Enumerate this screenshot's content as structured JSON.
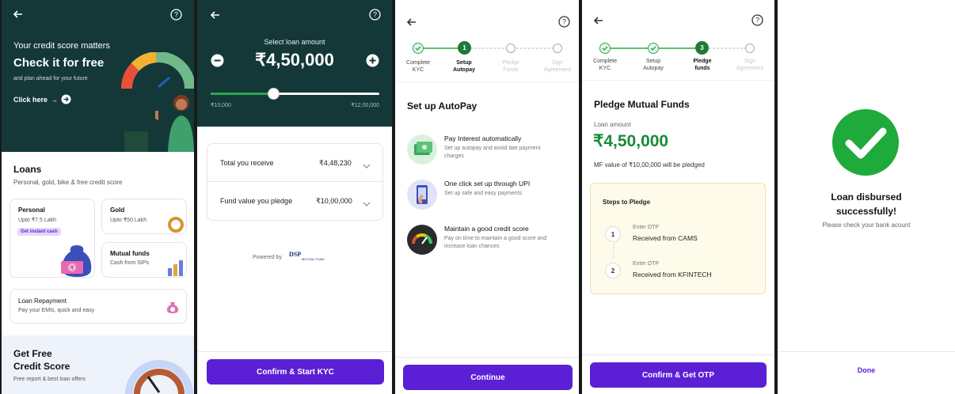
{
  "screen1": {
    "hero_subtitle": "Your credit score matters",
    "hero_title": "Check it for free",
    "hero_tagline": "and plan ahead for your future",
    "hero_link": "Click here",
    "loans_title": "Loans",
    "loans_subtitle": "Personal, gold, bike & free credit score",
    "personal_title": "Personal",
    "personal_sub": "Upto ₹7.5 Lakh",
    "personal_badge": "Get instant cash",
    "gold_title": "Gold",
    "gold_sub": "Upto ₹50 Lakh",
    "mf_title": "Mutual funds",
    "mf_sub": "Cash from SIPs",
    "repay_title": "Loan Repayment",
    "repay_sub": "Pay your EMIs, quick and easy",
    "promo_title_1": "Get Free",
    "promo_title_2": "Credit Score",
    "promo_sub": "Free report & best loan offers"
  },
  "screen2": {
    "select_label": "Select loan amount",
    "amount": "₹4,50,000",
    "slider_min": "₹10,000",
    "slider_max": "₹12,00,000",
    "slider_fraction": 0.37,
    "row1_label": "Total you receive",
    "row1_value": "₹4,48,230",
    "row2_label": "Fund value you pledge",
    "row2_value": "₹10,00,000",
    "powered_by": "Powered by",
    "powered_logo": "DSP",
    "powered_logo_sub": "MUTUAL FUND",
    "cta": "Confirm & Start KYC"
  },
  "screen3": {
    "steps": [
      {
        "l1": "Complete",
        "l2": "KYC"
      },
      {
        "l1": "Setup",
        "l2": "Autopay"
      },
      {
        "l1": "Pledge",
        "l2": "Funds"
      },
      {
        "l1": "Sign",
        "l2": "Agreement"
      }
    ],
    "active_step_number": "1",
    "title": "Set up AutoPay",
    "items": [
      {
        "title": "Pay Interest automatically",
        "sub1": "Set up autopay and avoid late payment",
        "sub2": "charges"
      },
      {
        "title": "One click set up through UPI",
        "sub1": "Set up safe and easy payments",
        "sub2": ""
      },
      {
        "title": "Maintain a good credit score",
        "sub1": "Pay on time to maintain a good score and",
        "sub2": "increase loan chances"
      }
    ],
    "cta": "Continue"
  },
  "screen4": {
    "steps": [
      {
        "l1": "Complete",
        "l2": "KYC"
      },
      {
        "l1": "Setup",
        "l2": "Autopay"
      },
      {
        "l1": "Pledge",
        "l2": "funds"
      },
      {
        "l1": "Sign",
        "l2": "Agreement"
      }
    ],
    "active_step_number": "3",
    "title": "Pledge Mutual Funds",
    "loan_label": "Loan amount",
    "amount": "₹4,50,000",
    "mf_note": "MF value of ₹10,00,000 will be pledged",
    "steps_title": "Steps to Pledge",
    "pledge_steps": [
      {
        "num": "1",
        "small": "Enter OTP",
        "big": "Received from CAMS"
      },
      {
        "num": "2",
        "small": "Enter OTP",
        "big": "Received from KFINTECH"
      }
    ],
    "cta": "Confirm & Get OTP"
  },
  "screen5": {
    "title_1": "Loan disbursed",
    "title_2": "successfully!",
    "sub": "Please check your bank acount",
    "cta": "Done"
  },
  "colors": {
    "dark_teal": "#143838",
    "purple": "#5b1fd6",
    "green": "#1f9a3a",
    "amount_green": "#1a8a3a"
  }
}
